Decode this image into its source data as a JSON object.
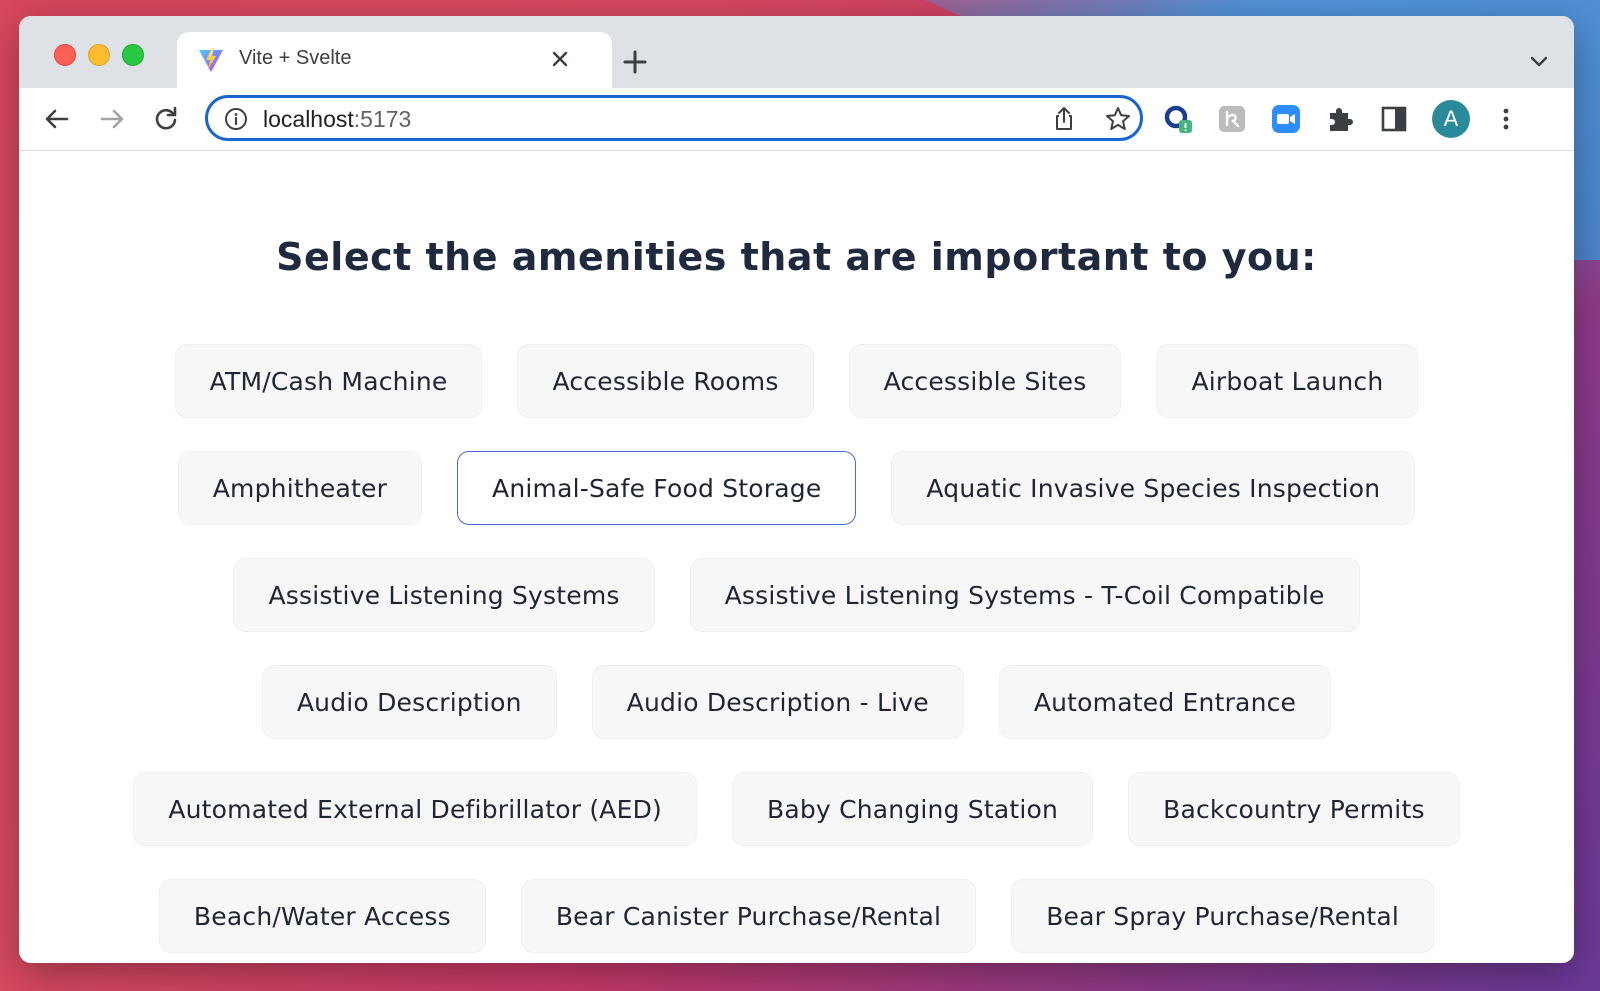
{
  "browser": {
    "tab": {
      "title": "Vite + Svelte"
    },
    "address_bar": {
      "host": "localhost",
      "port": ":5173"
    },
    "profile_initial": "A",
    "accent": "#1a65d1"
  },
  "page": {
    "heading": "Select the amenities that are important to you:",
    "selected_accent": "#4a6ad8",
    "amenity_rows": [
      [
        {
          "label": "ATM/Cash Machine",
          "selected": false
        },
        {
          "label": "Accessible Rooms",
          "selected": false
        },
        {
          "label": "Accessible Sites",
          "selected": false
        },
        {
          "label": "Airboat Launch",
          "selected": false
        }
      ],
      [
        {
          "label": "Amphitheater",
          "selected": false
        },
        {
          "label": "Animal-Safe Food Storage",
          "selected": true
        },
        {
          "label": "Aquatic Invasive Species Inspection",
          "selected": false
        }
      ],
      [
        {
          "label": "Assistive Listening Systems",
          "selected": false
        },
        {
          "label": "Assistive Listening Systems - T-Coil Compatible",
          "selected": false
        }
      ],
      [
        {
          "label": "Audio Description",
          "selected": false
        },
        {
          "label": "Audio Description - Live",
          "selected": false
        },
        {
          "label": "Automated Entrance",
          "selected": false
        }
      ],
      [
        {
          "label": "Automated External Defibrillator (AED)",
          "selected": false
        },
        {
          "label": "Baby Changing Station",
          "selected": false
        },
        {
          "label": "Backcountry Permits",
          "selected": false
        }
      ],
      [
        {
          "label": "Beach/Water Access",
          "selected": false
        },
        {
          "label": "Bear Canister Purchase/Rental",
          "selected": false
        },
        {
          "label": "Bear Spray Purchase/Rental",
          "selected": false
        }
      ]
    ]
  }
}
